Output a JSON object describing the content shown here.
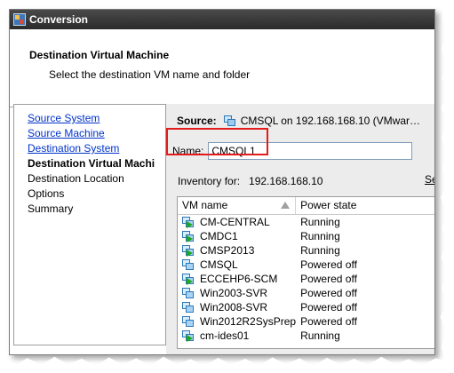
{
  "window": {
    "title": "Conversion"
  },
  "header": {
    "title": "Destination Virtual Machine",
    "subtitle": "Select the destination VM name and folder"
  },
  "steps": [
    {
      "label": "Source System",
      "state": "link"
    },
    {
      "label": "Source Machine",
      "state": "link"
    },
    {
      "label": "Destination System",
      "state": "link"
    },
    {
      "label": "Destination Virtual Machi",
      "state": "current"
    },
    {
      "label": "Destination Location",
      "state": "pending"
    },
    {
      "label": "Options",
      "state": "pending"
    },
    {
      "label": "Summary",
      "state": "pending"
    }
  ],
  "source": {
    "label": "Source:",
    "value": "CMSQL on 192.168.168.10 (VMwar…"
  },
  "name_field": {
    "label": "Name:",
    "value": "CMSQL1"
  },
  "inventory": {
    "label": "Inventory for:",
    "host": "192.168.168.10",
    "search_label": "Sea"
  },
  "vm_list": {
    "columns": [
      "VM name",
      "Power state"
    ],
    "rows": [
      {
        "name": "CM-CENTRAL",
        "state": "Running",
        "icon": "vm-powered-on-icon"
      },
      {
        "name": "CMDC1",
        "state": "Running",
        "icon": "vm-powered-on-icon"
      },
      {
        "name": "CMSP2013",
        "state": "Running",
        "icon": "vm-powered-on-icon"
      },
      {
        "name": "CMSQL",
        "state": "Powered off",
        "icon": "vm-icon"
      },
      {
        "name": "ECCEHP6-SCM",
        "state": "Powered off",
        "icon": "vm-powered-on-icon"
      },
      {
        "name": "Win2003-SVR",
        "state": "Powered off",
        "icon": "vm-icon"
      },
      {
        "name": "Win2008-SVR",
        "state": "Powered off",
        "icon": "vm-icon"
      },
      {
        "name": "Win2012R2SysPrep",
        "state": "Powered off",
        "icon": "vm-icon"
      },
      {
        "name": "cm-ides01",
        "state": "Running",
        "icon": "vm-powered-on-icon"
      }
    ]
  },
  "colors": {
    "link": "#0033cc",
    "highlight_box": "#e31b1b",
    "panel_background": "#ececec",
    "powered_on_arrow": "#1fa81f"
  }
}
